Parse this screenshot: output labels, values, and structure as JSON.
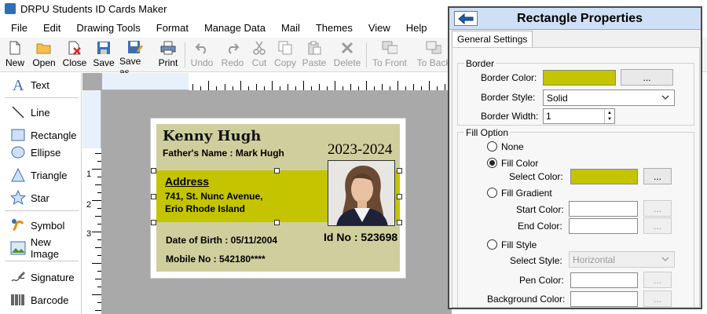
{
  "app": {
    "title": "DRPU Students ID Cards Maker"
  },
  "menu": [
    "File",
    "Edit",
    "Drawing Tools",
    "Format",
    "Manage Data",
    "Mail",
    "Themes",
    "View",
    "Help"
  ],
  "toolbar": {
    "new": "New",
    "open": "Open",
    "close": "Close",
    "save": "Save",
    "save_as": "Save as",
    "print": "Print",
    "undo": "Undo",
    "redo": "Redo",
    "cut": "Cut",
    "copy": "Copy",
    "paste": "Paste",
    "delete": "Delete",
    "to_front": "To Front",
    "to_back": "To Back"
  },
  "tools": {
    "text": "Text",
    "line": "Line",
    "rectangle": "Rectangle",
    "ellipse": "Ellipse",
    "triangle": "Triangle",
    "star": "Star",
    "symbol": "Symbol",
    "new_image": "New Image",
    "signature": "Signature",
    "barcode": "Barcode"
  },
  "ruler": {
    "v1": "1",
    "v2": "2",
    "v3": "3"
  },
  "card": {
    "name": "Kenny Hugh",
    "father": "Father's Name :  Mark Hugh",
    "year": "2023-2024",
    "address_label": "Address",
    "address_line1": "741, St. Nunc Avenue,",
    "address_line2": "Erio Rhode Island",
    "id_no": "Id No :  523698",
    "dob": "Date of Birth :  05/11/2004",
    "mobile": "Mobile No :  542180****"
  },
  "panel": {
    "title": "Rectangle Properties",
    "tab": "General Settings",
    "border_group": "Border",
    "border_color_label": "Border Color:",
    "border_color": "#c4c400",
    "border_style_label": "Border Style:",
    "border_style": "Solid",
    "border_width_label": "Border Width:",
    "border_width": "1",
    "fill_group": "Fill Option",
    "fill_none": "None",
    "fill_color": "Fill Color",
    "select_color_label": "Select Color:",
    "select_color": "#c4c400",
    "fill_gradient": "Fill Gradient",
    "start_color_label": "Start Color:",
    "end_color_label": "End Color:",
    "fill_style": "Fill Style",
    "select_style_label": "Select Style:",
    "select_style": "Horizontal",
    "pen_color_label": "Pen Color:",
    "background_color_label": "Background Color:",
    "dots": "..."
  }
}
